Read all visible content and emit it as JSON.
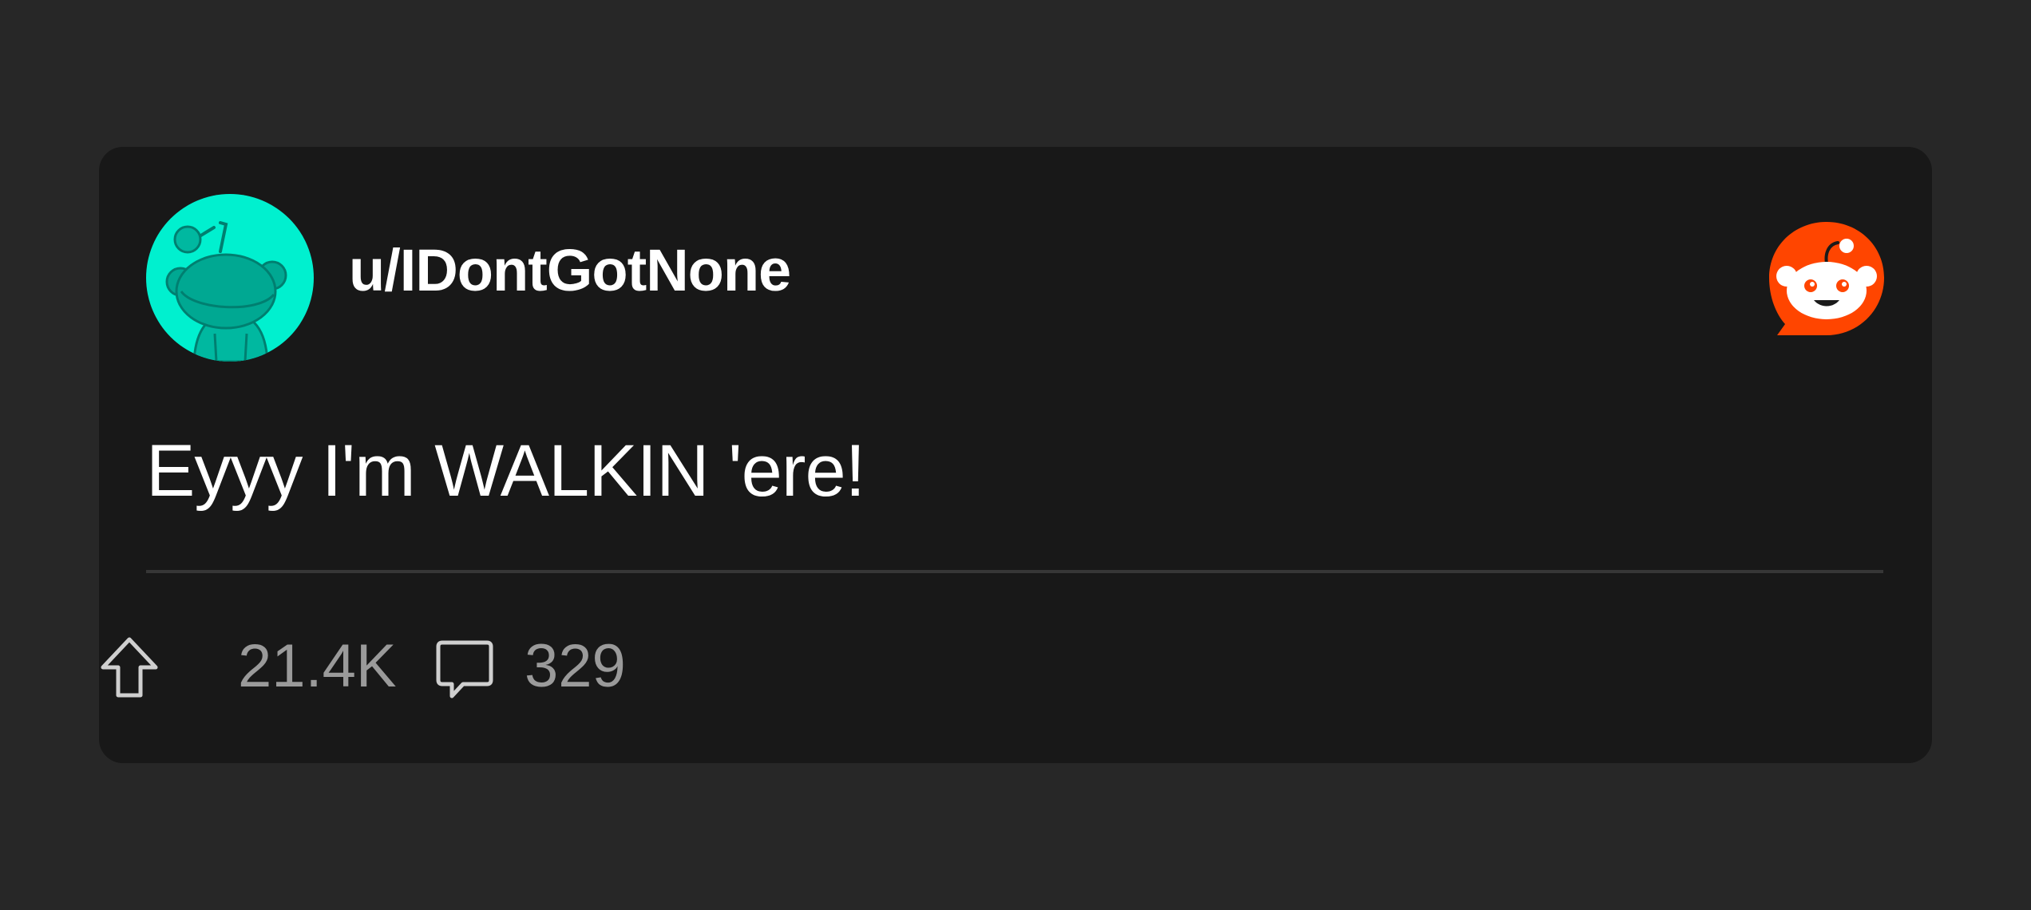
{
  "post": {
    "username": "u/IDontGotNone",
    "text": "Eyyy I'm WALKIN 'ere!",
    "upvotes": "21.4K",
    "comments": "329"
  },
  "icons": {
    "avatar": "snoo-avatar-icon",
    "brand": "reddit-logo-icon",
    "upvote": "upvote-arrow-icon",
    "comment": "comment-bubble-icon"
  },
  "colors": {
    "page_background": "#272727",
    "card_background": "#181818",
    "avatar_background": "#00F0CF",
    "avatar_snoo": "#009F8C",
    "brand_orange": "#FF4500",
    "primary_text": "#FFFFFF",
    "secondary_text": "#9A9A9A",
    "divider": "#363636"
  }
}
